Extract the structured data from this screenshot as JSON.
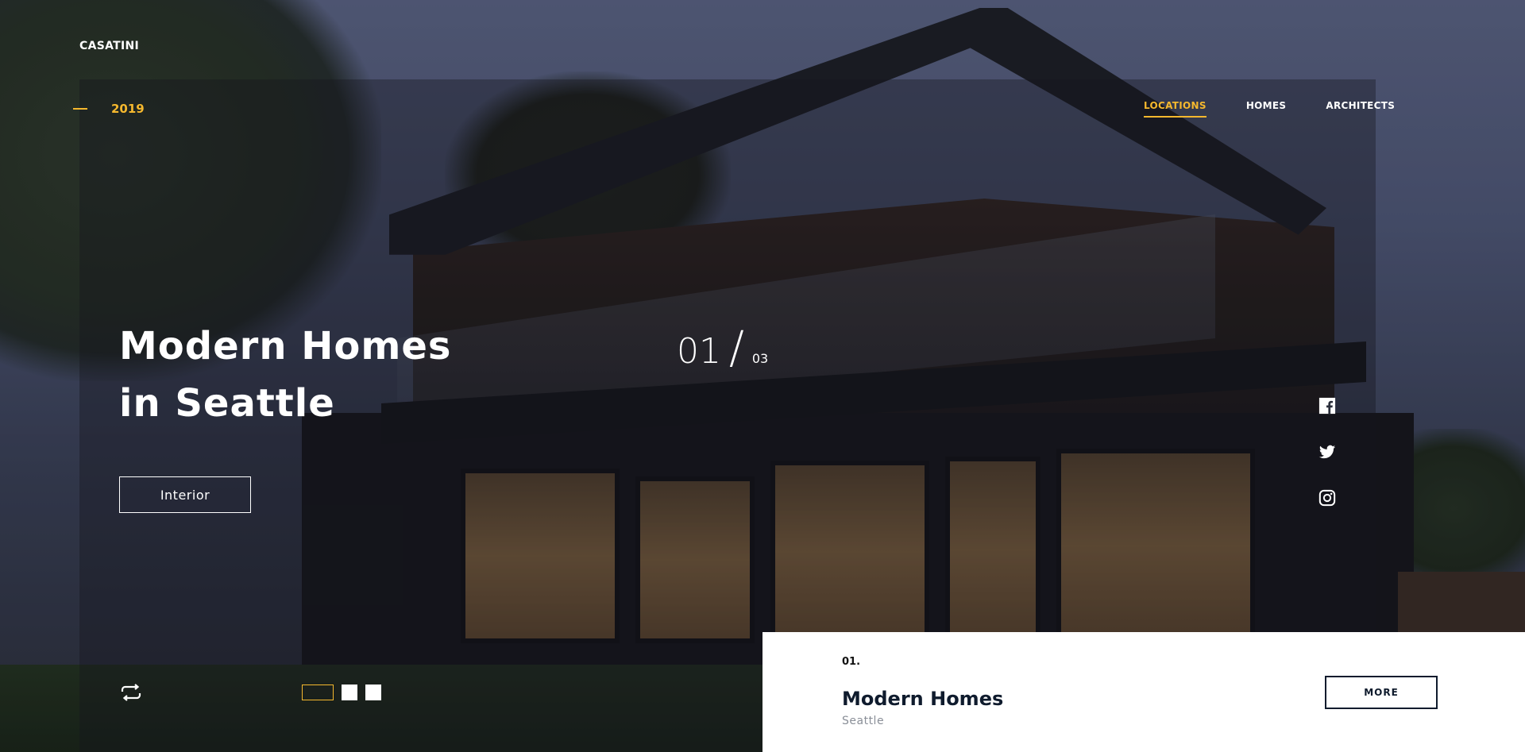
{
  "brand": {
    "name": "CASATINI"
  },
  "year": "2019",
  "nav": {
    "items": [
      {
        "label": "LOCATIONS",
        "active": true
      },
      {
        "label": "HOMES",
        "active": false
      },
      {
        "label": "ARCHITECTS",
        "active": false
      }
    ]
  },
  "hero": {
    "title_line1": "Modern Homes",
    "title_line2": "in Seattle",
    "category_button": "Interior",
    "counter_current": "01",
    "counter_slash": "/",
    "counter_total": "03"
  },
  "social": [
    "facebook-icon",
    "twitter-icon",
    "instagram-icon"
  ],
  "slider": {
    "current_index": 1,
    "total": 3
  },
  "card": {
    "number": "01.",
    "title": "Modern Homes",
    "subtitle": "Seattle",
    "more_label": "MORE"
  },
  "colors": {
    "accent": "#f5b82e",
    "dark": "#0f1b2d"
  }
}
